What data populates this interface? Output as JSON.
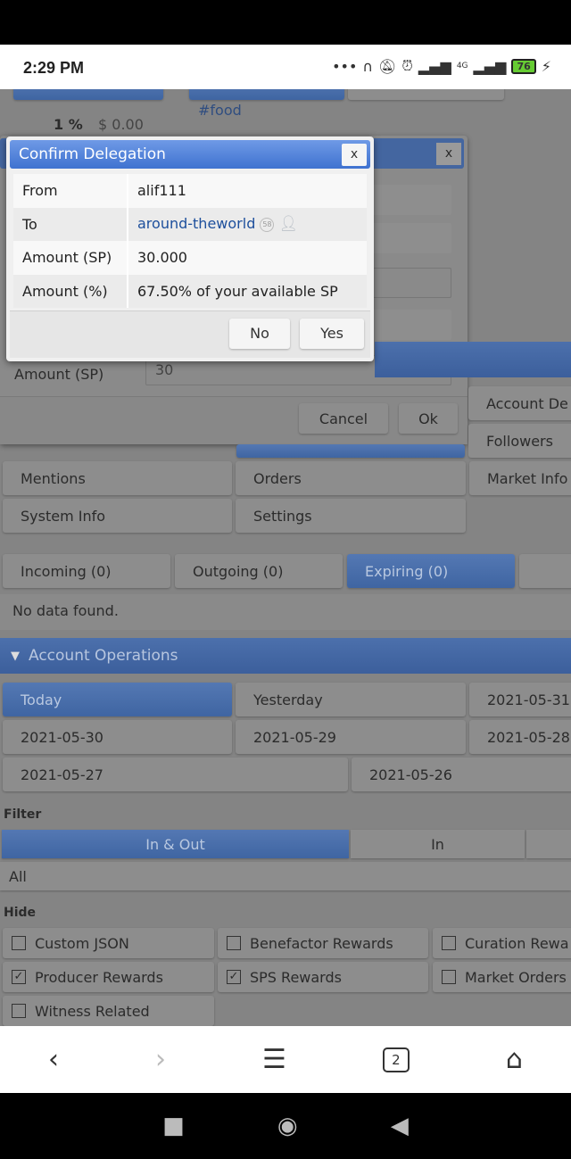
{
  "status": {
    "time": "2:29 PM",
    "battery": "76",
    "network": "4G"
  },
  "background": {
    "tag": "#food",
    "percent": "1 %",
    "amount": "$ 0.00",
    "amount_sp_label": "Amount (SP)",
    "amount_sp_value": "30",
    "cancel": "Cancel",
    "ok": "Ok",
    "close": "x",
    "menu": [
      "Account De",
      "Followers",
      "Mentions",
      "Orders",
      "Market Info",
      "System Info",
      "Settings"
    ],
    "delegation_tabs": [
      "Incoming (0)",
      "Outgoing (0)",
      "Expiring (0)"
    ],
    "no_data": "No data found.",
    "ops_header": "Account Operations",
    "dates": [
      "Today",
      "Yesterday",
      "2021-05-31",
      "2021-05-30",
      "2021-05-29",
      "2021-05-28",
      "2021-05-27",
      "2021-05-26"
    ],
    "filter_label": "Filter",
    "filter_tabs": [
      "In & Out",
      "In"
    ],
    "filter_select": "All",
    "hide_label": "Hide",
    "hide_items": [
      {
        "label": "Custom JSON",
        "checked": false
      },
      {
        "label": "Benefactor Rewards",
        "checked": false
      },
      {
        "label": "Curation Rewa",
        "checked": false
      },
      {
        "label": "Producer Rewards",
        "checked": true
      },
      {
        "label": "SPS Rewards",
        "checked": true
      },
      {
        "label": "Market Orders",
        "checked": false
      },
      {
        "label": "Witness Related",
        "checked": false
      }
    ]
  },
  "dialog": {
    "title": "Confirm Delegation",
    "close": "x",
    "rows": [
      {
        "key": "From",
        "value": "alif111"
      },
      {
        "key": "To",
        "value": "around-theworld",
        "reputation": "58"
      },
      {
        "key": "Amount (SP)",
        "value": "30.000"
      },
      {
        "key": "Amount (%)",
        "value": "67.50% of your available SP"
      }
    ],
    "no": "No",
    "yes": "Yes"
  },
  "browser": {
    "tabs_count": "2"
  }
}
